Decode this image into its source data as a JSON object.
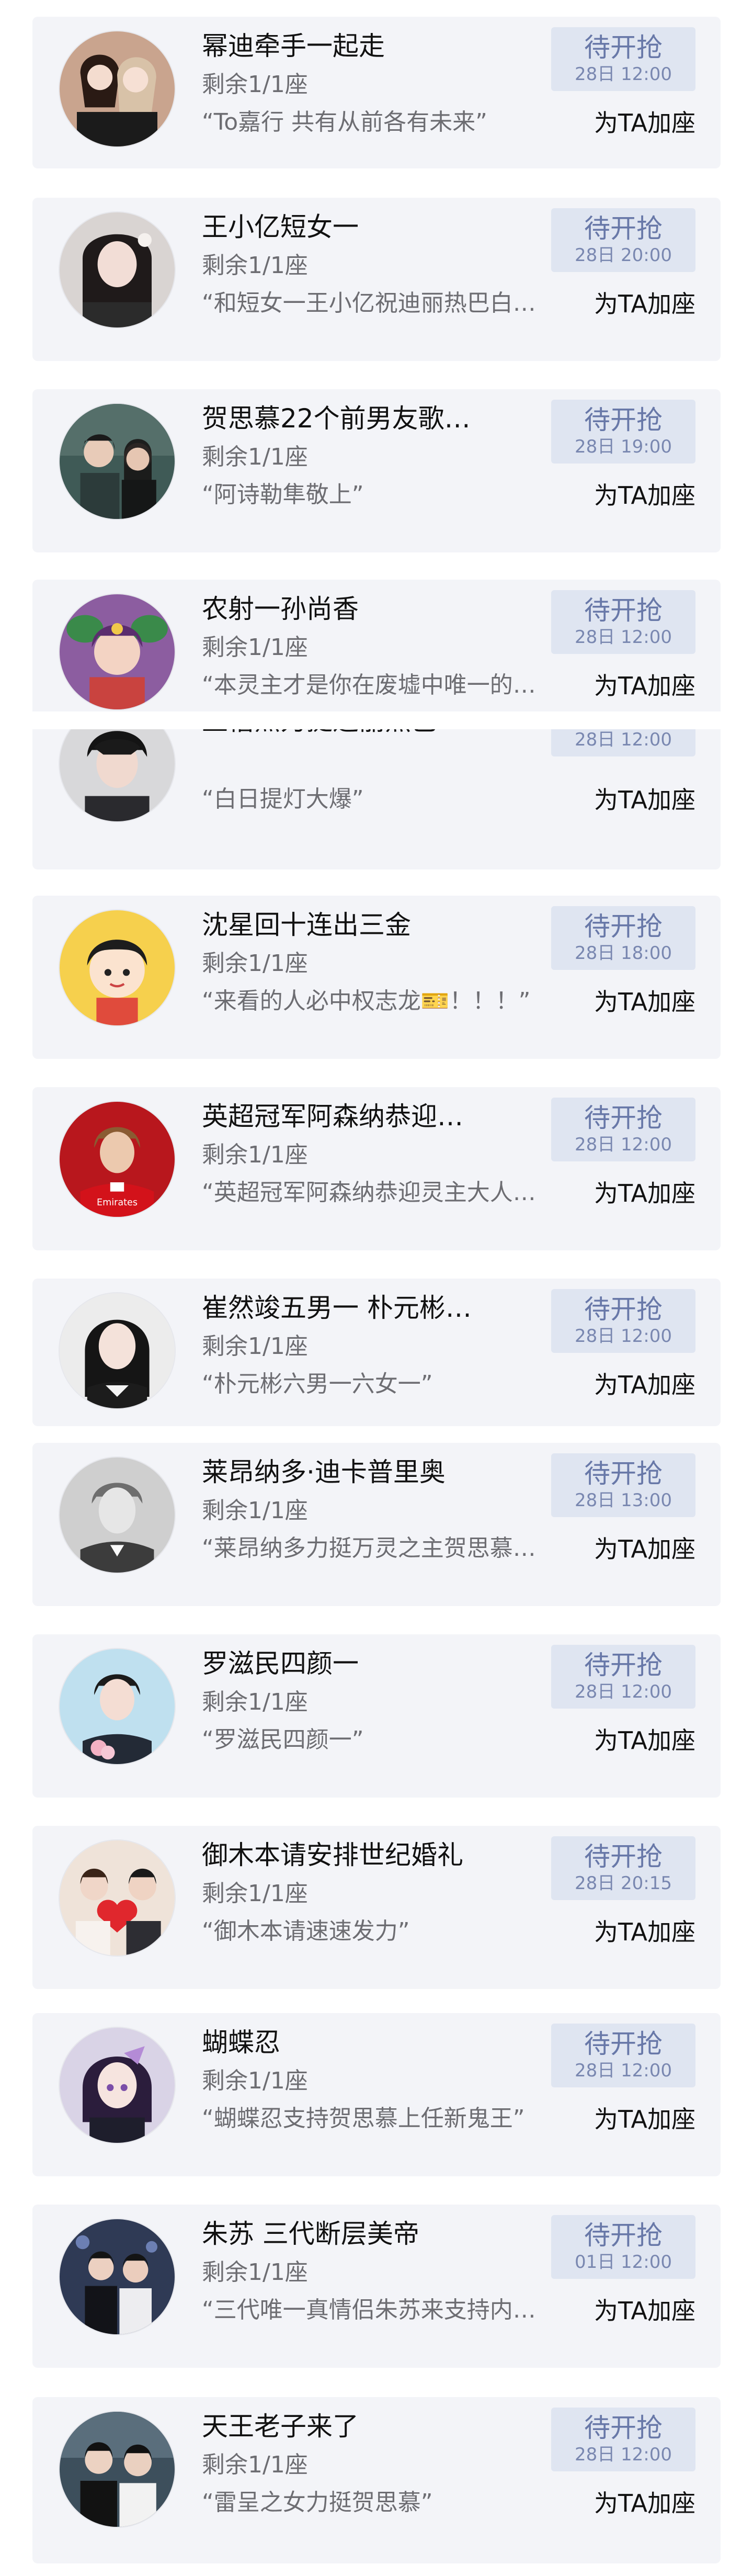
{
  "labels": {
    "grab": "待开抢",
    "join": "为TA加座",
    "seats": "剩余1/1座"
  },
  "colors": {
    "card_background": "#f3f4f8",
    "button_background": "#dfe5f1",
    "button_text": "#6878a8",
    "title_text": "#111111",
    "secondary_text": "#6d6d72"
  },
  "rooms": [
    {
      "title": "幂迪牵手一起走",
      "time": "28日 12:00",
      "quote": "“To嘉行 共有从前各有未来”",
      "avatar": "two-women-photo-icon"
    },
    {
      "title": "王小亿短女一",
      "time": "28日 20:00",
      "quote": "“和短女一王小亿祝迪丽热巴白…",
      "avatar": "woman-portrait-icon"
    },
    {
      "title": "贺思慕22个前男友歌…",
      "time": "28日 19:00",
      "quote": "“阿诗勒隼敬上”",
      "avatar": "drama-couple-icon"
    },
    {
      "title": "农射一孙尚香",
      "time": "28日 12:00",
      "quote": "“本灵主才是你在废墟中唯一的…",
      "avatar": "game-heroine-icon"
    },
    {
      "title": "王楷杰力挺迪丽热巴",
      "time": "28日 12:00",
      "quote": "“白日提灯大爆”",
      "avatar": "young-man-portrait-icon"
    },
    {
      "title": "沈星回十连出三金",
      "time": "28日 18:00",
      "quote": "“来看的人必中权志龙🎫！！！”",
      "avatar": "cartoon-girl-icon"
    },
    {
      "title": "英超冠军阿森纳恭迎…",
      "time": "28日 12:00",
      "quote": "“英超冠军阿森纳恭迎灵主大人…",
      "avatar": "football-player-icon"
    },
    {
      "title": "崔然竣五男一 朴元彬…",
      "time": "28日 12:00",
      "quote": "“朴元彬六男一六女一”",
      "avatar": "dark-hair-woman-icon"
    },
    {
      "title": "莱昂纳多·迪卡普里奥",
      "time": "28日 13:00",
      "quote": "“莱昂纳多力挺万灵之主贺思慕…",
      "avatar": "bw-actor-portrait-icon"
    },
    {
      "title": "罗滋民四颜一",
      "time": "28日 12:00",
      "quote": "“罗滋民四颜一”",
      "avatar": "man-with-flowers-icon"
    },
    {
      "title": "御木本请安排世纪婚礼",
      "time": "28日 20:15",
      "quote": "“御木本请速速发力”",
      "avatar": "wedding-couple-icon"
    },
    {
      "title": "蝴蝶忍",
      "time": "28日 12:00",
      "quote": "“蝴蝶忍支持贺思慕上任新鬼王”",
      "avatar": "anime-girl-icon"
    },
    {
      "title": "朱苏 三代断层美帝",
      "time": "01日 12:00",
      "quote": "“三代唯一真情侣朱苏来支持内…",
      "avatar": "stage-couple-icon"
    },
    {
      "title": "天王老子来了",
      "time": "28日 12:00",
      "quote": "“雷呈之女力挺贺思慕”",
      "avatar": "two-men-photo-icon"
    }
  ]
}
